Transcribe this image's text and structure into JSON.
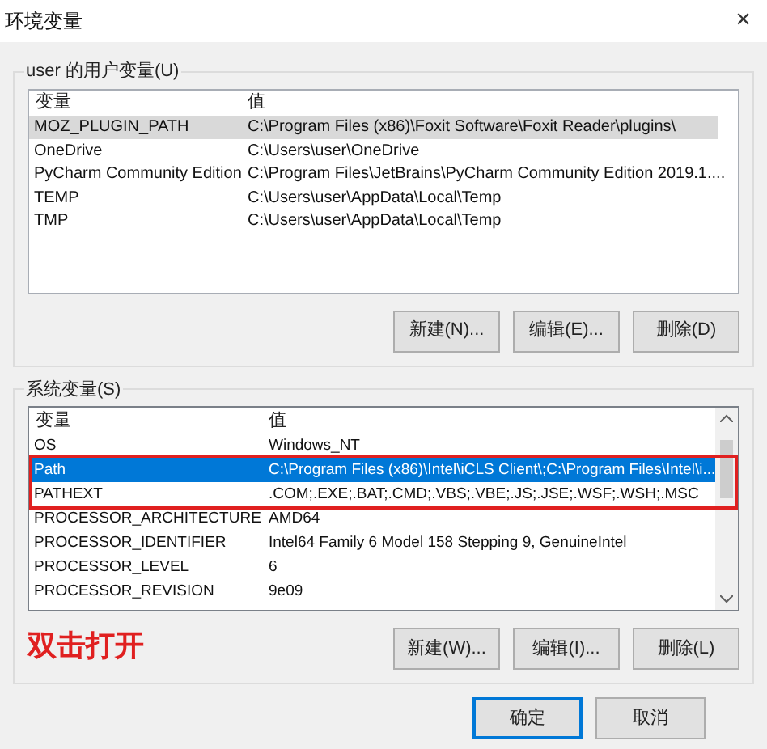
{
  "window": {
    "title": "环境变量",
    "close": "×"
  },
  "user_vars": {
    "label": "user 的用户变量(U)",
    "focused": false,
    "columns": [
      "变量",
      "值"
    ],
    "rows": [
      {
        "name": "MOZ_PLUGIN_PATH",
        "value": "C:\\Program Files (x86)\\Foxit Software\\Foxit Reader\\plugins\\",
        "selected": true
      },
      {
        "name": "OneDrive",
        "value": "C:\\Users\\user\\OneDrive",
        "selected": false
      },
      {
        "name": "PyCharm Community Edition",
        "value": "C:\\Program Files\\JetBrains\\PyCharm Community Edition 2019.1....",
        "selected": false
      },
      {
        "name": "TEMP",
        "value": "C:\\Users\\user\\AppData\\Local\\Temp",
        "selected": false
      },
      {
        "name": "TMP",
        "value": "C:\\Users\\user\\AppData\\Local\\Temp",
        "selected": false
      }
    ],
    "buttons": [
      "新建(N)...",
      "编辑(E)...",
      "删除(D)"
    ]
  },
  "system_vars": {
    "label": "系统变量(S)",
    "focused": true,
    "columns": [
      "变量",
      "值"
    ],
    "rows": [
      {
        "name": "OS",
        "value": "Windows_NT",
        "selected": false
      },
      {
        "name": "Path",
        "value": "C:\\Program Files (x86)\\Intel\\iCLS Client\\;C:\\Program Files\\Intel\\i...",
        "selected": true
      },
      {
        "name": "PATHEXT",
        "value": ".COM;.EXE;.BAT;.CMD;.VBS;.VBE;.JS;.JSE;.WSF;.WSH;.MSC",
        "selected": false
      },
      {
        "name": "PROCESSOR_ARCHITECTURE",
        "value": "AMD64",
        "selected": false
      },
      {
        "name": "PROCESSOR_IDENTIFIER",
        "value": "Intel64 Family 6 Model 158 Stepping 9, GenuineIntel",
        "selected": false
      },
      {
        "name": "PROCESSOR_LEVEL",
        "value": "6",
        "selected": false
      },
      {
        "name": "PROCESSOR_REVISION",
        "value": "9e09",
        "selected": false
      }
    ],
    "buttons": [
      "新建(W)...",
      "编辑(I)...",
      "删除(L)"
    ]
  },
  "annotation": {
    "text": "双击打开"
  },
  "footer_buttons": [
    {
      "label": "确定",
      "default": true
    },
    {
      "label": "取消",
      "default": false
    }
  ]
}
